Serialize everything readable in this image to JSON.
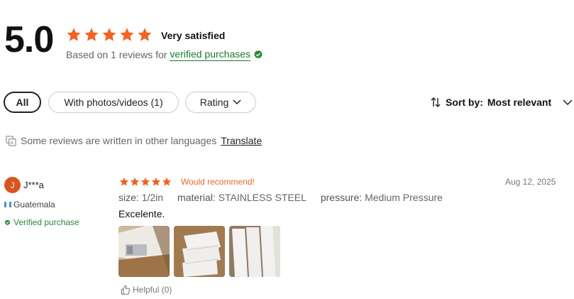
{
  "summary": {
    "score": "5.0",
    "rating_label": "Very satisfied",
    "stars": 5,
    "based_on_text": "Based on 1 reviews for",
    "verified_link": "verified purchases"
  },
  "filters": {
    "all": "All",
    "photos": "With photos/videos (1)",
    "rating": "Rating"
  },
  "sort": {
    "prefix": "Sort by:",
    "value": "Most relevant"
  },
  "notice": {
    "text": "Some reviews are written in other languages",
    "link": "Translate"
  },
  "review": {
    "avatar_initial": "J",
    "username": "J***a",
    "country": "Guatemala",
    "verified": "Verified purchase",
    "stars": 5,
    "recommend": "Would recommend!",
    "date": "Aug 12, 2025",
    "attributes": [
      {
        "key": "size:",
        "value": "1/2in"
      },
      {
        "key": "material:",
        "value": "STAINLESS STEEL"
      },
      {
        "key": "pressure:",
        "value": "Medium Pressure"
      }
    ],
    "text": "Excelente.",
    "helpful": "Helpful (0)"
  },
  "colors": {
    "star": "#f26322",
    "verified_green": "#1a7a2a",
    "recommend": "#e8672a",
    "avatar": "#d9541f"
  }
}
